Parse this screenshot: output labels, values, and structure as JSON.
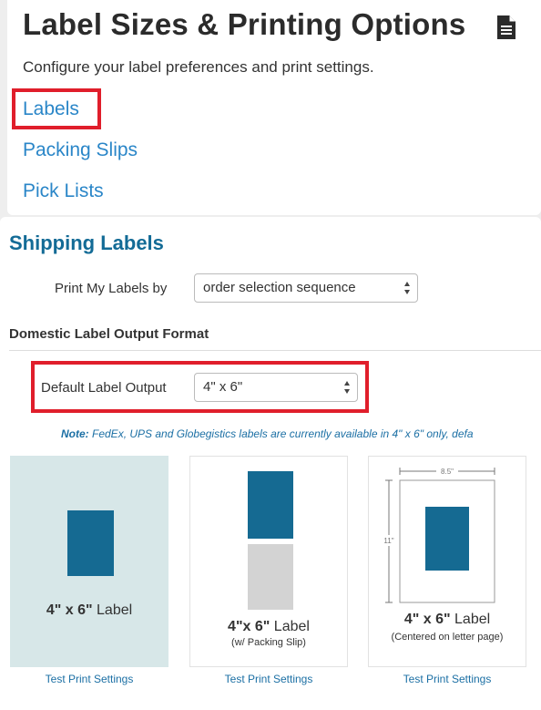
{
  "header": {
    "title": "Label Sizes & Printing Options",
    "subtitle": "Configure your label preferences and print settings.",
    "title_icon": "document-icon"
  },
  "nav": {
    "items": [
      {
        "label": "Labels",
        "highlighted": true
      },
      {
        "label": "Packing Slips"
      },
      {
        "label": "Pick Lists"
      }
    ]
  },
  "shipping": {
    "title": "Shipping Labels",
    "print_by_label": "Print My Labels by",
    "print_by_value": "order selection sequence",
    "domestic_heading": "Domestic Label Output Format",
    "default_output_label": "Default Label Output",
    "default_output_value": "4\" x 6\"",
    "note_prefix": "Note:",
    "note_text": " FedEx, UPS and Globegistics labels are currently available in 4\" x 6\" only, defa"
  },
  "options": [
    {
      "size": "4\" x 6\"",
      "word": " Label",
      "sub": "",
      "link": "Test Print Settings",
      "selected": true
    },
    {
      "size": "4\"x 6\"",
      "word": " Label",
      "sub": "(w/ Packing Slip)",
      "link": "Test Print Settings"
    },
    {
      "size": "4\" x 6\"",
      "word": " Label",
      "sub": "(Centered on letter page)",
      "link": "Test Print Settings",
      "dim_width": "8.5\"",
      "dim_height": "11\""
    }
  ],
  "colors": {
    "accent": "#136b96",
    "link": "#2a86c8",
    "label_block": "#156a92",
    "highlight": "#e01e2b",
    "selected_bg": "#d7e7e8"
  }
}
